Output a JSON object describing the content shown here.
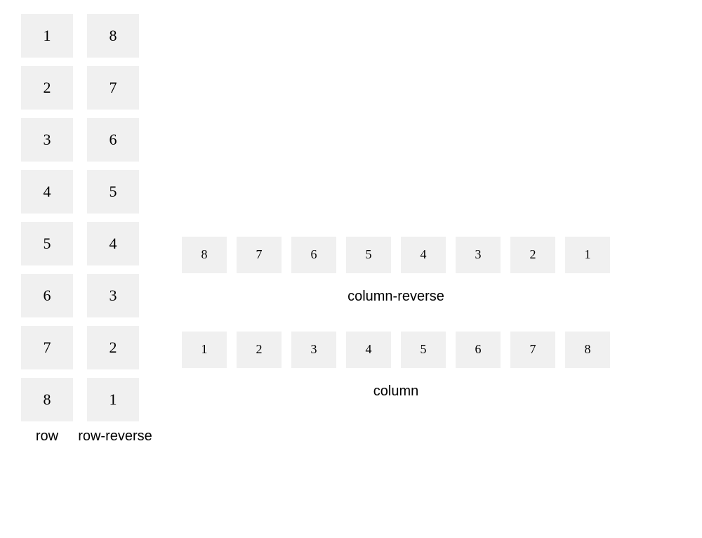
{
  "layouts": {
    "row": {
      "label": "row",
      "items": [
        "1",
        "2",
        "3",
        "4",
        "5",
        "6",
        "7",
        "8"
      ]
    },
    "row_reverse": {
      "label": "row-reverse",
      "items": [
        "8",
        "7",
        "6",
        "5",
        "4",
        "3",
        "2",
        "1"
      ]
    },
    "column_reverse": {
      "label": "column-reverse",
      "items": [
        "8",
        "7",
        "6",
        "5",
        "4",
        "3",
        "2",
        "1"
      ]
    },
    "column": {
      "label": "column",
      "items": [
        "1",
        "2",
        "3",
        "4",
        "5",
        "6",
        "7",
        "8"
      ]
    }
  }
}
